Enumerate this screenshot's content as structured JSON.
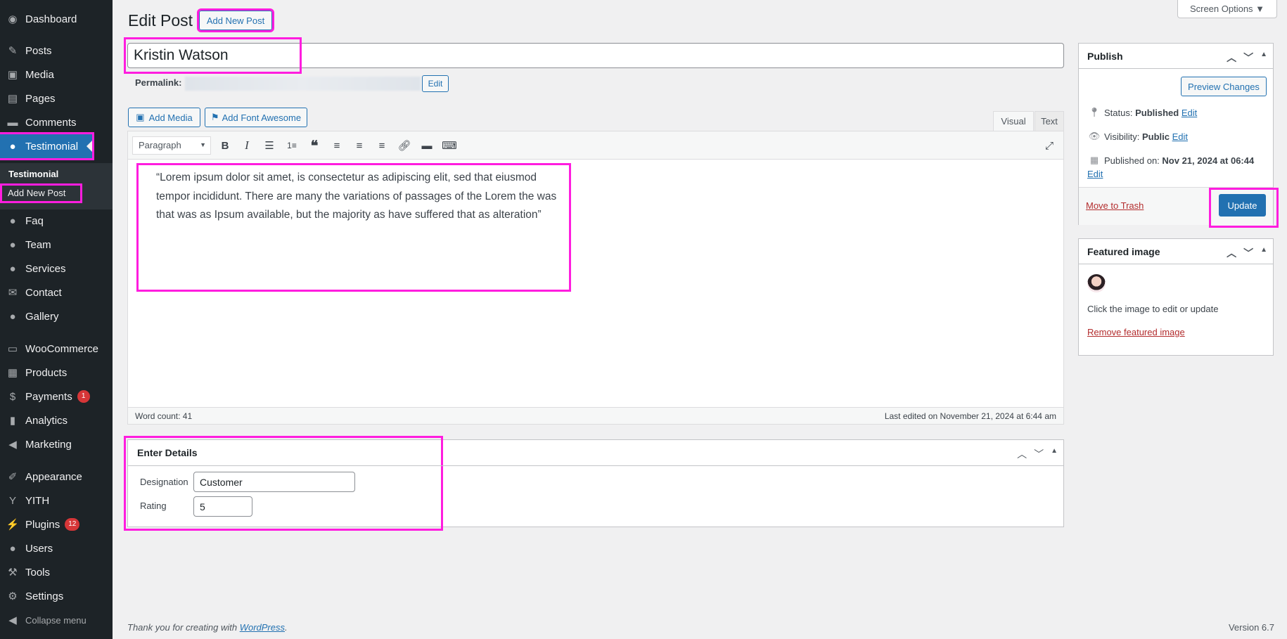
{
  "sidebar": {
    "items": [
      {
        "label": "Dashboard",
        "icon": "dashboard-icon",
        "glyph": "◉"
      },
      {
        "label": "Posts",
        "icon": "pin-icon",
        "glyph": "✎"
      },
      {
        "label": "Media",
        "icon": "media-icon",
        "glyph": "▣"
      },
      {
        "label": "Pages",
        "icon": "pages-icon",
        "glyph": "▤"
      },
      {
        "label": "Comments",
        "icon": "comments-icon",
        "glyph": "▬"
      },
      {
        "label": "Testimonial",
        "icon": "person-icon",
        "glyph": "●"
      },
      {
        "label": "Faq",
        "icon": "person-icon",
        "glyph": "●"
      },
      {
        "label": "Team",
        "icon": "person-icon",
        "glyph": "●"
      },
      {
        "label": "Services",
        "icon": "person-icon",
        "glyph": "●"
      },
      {
        "label": "Contact",
        "icon": "mail-icon",
        "glyph": "✉"
      },
      {
        "label": "Gallery",
        "icon": "person-icon",
        "glyph": "●"
      },
      {
        "label": "WooCommerce",
        "icon": "woo-icon",
        "glyph": "▭"
      },
      {
        "label": "Products",
        "icon": "archive-icon",
        "glyph": "▦"
      },
      {
        "label": "Payments",
        "icon": "payments-icon",
        "glyph": "$",
        "badge": "1"
      },
      {
        "label": "Analytics",
        "icon": "chart-icon",
        "glyph": "▮"
      },
      {
        "label": "Marketing",
        "icon": "megaphone-icon",
        "glyph": "◀"
      },
      {
        "label": "Appearance",
        "icon": "brush-icon",
        "glyph": "✐"
      },
      {
        "label": "YITH",
        "icon": "yith-icon",
        "glyph": "Y"
      },
      {
        "label": "Plugins",
        "icon": "plugin-icon",
        "glyph": "⚡",
        "badge": "12"
      },
      {
        "label": "Users",
        "icon": "users-icon",
        "glyph": "●"
      },
      {
        "label": "Tools",
        "icon": "wrench-icon",
        "glyph": "⚒"
      },
      {
        "label": "Settings",
        "icon": "settings-icon",
        "glyph": "⚙"
      }
    ],
    "submenu_title": "Testimonial",
    "submenu_item": "Add New Post",
    "collapse": "Collapse menu"
  },
  "header": {
    "title": "Edit Post",
    "add_new": "Add New Post",
    "screen_options": "Screen Options ▼"
  },
  "post": {
    "title": "Kristin Watson",
    "permalink_label": "Permalink:",
    "permalink_edit": "Edit"
  },
  "editor": {
    "add_media": "Add Media",
    "add_font_awesome": "Add Font Awesome",
    "tab_visual": "Visual",
    "tab_text": "Text",
    "format": "Paragraph",
    "content": "“Lorem ipsum dolor sit amet, is consectetur as adipiscing elit, sed that eiusmod tempor incididunt. There are many the variations of passages of the Lorem the was that was as Ipsum available, but the majority as have suffered that as alteration”",
    "word_count": "Word count: 41",
    "last_edited": "Last edited on November 21, 2024 at 6:44 am"
  },
  "details": {
    "title": "Enter Details",
    "designation_label": "Designation",
    "designation_value": "Customer",
    "rating_label": "Rating",
    "rating_value": "5"
  },
  "publish": {
    "title": "Publish",
    "preview": "Preview Changes",
    "status_label": "Status:",
    "status_value": "Published",
    "visibility_label": "Visibility:",
    "visibility_value": "Public",
    "published_label": "Published on:",
    "published_value": "Nov 21, 2024 at 06:44",
    "edit": "Edit",
    "trash": "Move to Trash",
    "update": "Update"
  },
  "featured": {
    "title": "Featured image",
    "hint": "Click the image to edit or update",
    "remove": "Remove featured image"
  },
  "footer": {
    "thanks": "Thank you for creating with ",
    "wp": "WordPress",
    "dot": ".",
    "version": "Version 6.7"
  },
  "colors": {
    "accent": "#2271b1",
    "highlight": "#ff1ddf",
    "sidebar": "#1d2327"
  }
}
